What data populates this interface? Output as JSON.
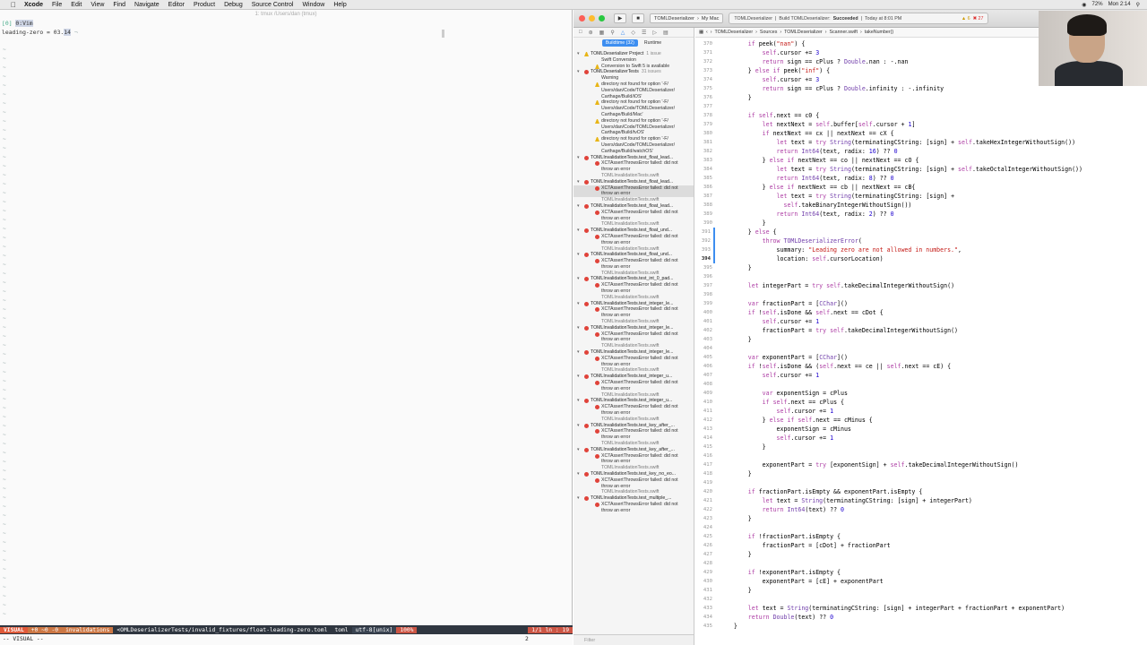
{
  "menubar": {
    "app": "Xcode",
    "items": [
      "File",
      "Edit",
      "View",
      "Find",
      "Navigate",
      "Editor",
      "Product",
      "Debug",
      "Source Control",
      "Window",
      "Help"
    ],
    "right": [
      "72%",
      "Mon 2:14"
    ]
  },
  "terminal": {
    "title": "1: tmux /Users/dan (tmux)",
    "line1_tag": "[0]",
    "line1_sel": "0:Vim",
    "line2_key": "leading-zero = ",
    "line2_val_a": "03.",
    "line2_val_b": "14",
    "status": {
      "mode": "VISUAL",
      "flags": "+0 ~0 -0",
      "branch": "invalidations",
      "file": "<OMLDeserializerTests/invalid_fixtures/float-leading-zero.toml",
      "ft": "toml",
      "enc": "utf-8[unix]",
      "pct": "100%",
      "pos": "1/1 ln : 19"
    },
    "cmd": "-- VISUAL --",
    "cmd_count": "2"
  },
  "xcode": {
    "toolbar": {
      "scheme_target": "TOMLDeserializer",
      "scheme_device": "My Mac",
      "activity_project": "TOMLDeserializer",
      "activity_action": "Build TOMLDeserializer:",
      "activity_status": "Succeeded",
      "activity_time": "Today at 8:01 PM",
      "warn_count": "6",
      "err_count": "27"
    },
    "navigator": {
      "seg_on": "Buildtime (32)",
      "seg_off": "Runtime",
      "filter": "Filter",
      "issues": [
        {
          "kind": "grp",
          "icon": "warn",
          "text": "TOMLDeserializer Project",
          "count": "1 issue"
        },
        {
          "kind": "sub",
          "icon": "",
          "text": "Swift Conversion"
        },
        {
          "kind": "msg",
          "icon": "warn",
          "text": "Conversion to Swift 5 is available"
        },
        {
          "kind": "grp",
          "icon": "err",
          "text": "TOMLDeserializerTests",
          "count": "31 issues"
        },
        {
          "kind": "sub",
          "icon": "",
          "text": "Warning"
        },
        {
          "kind": "msg",
          "icon": "warn",
          "text": "directory not found for option '-F/\nUsers/dan/Code/TOMLDeserializer/\nCarthage/Build/iOS'"
        },
        {
          "kind": "msg",
          "icon": "warn",
          "text": "directory not found for option '-F/\nUsers/dan/Code/TOMLDeserializer/\nCarthage/Build/Mac'"
        },
        {
          "kind": "msg",
          "icon": "warn",
          "text": "directory not found for option '-F/\nUsers/dan/Code/TOMLDeserializer/\nCarthage/Build/tvOS'"
        },
        {
          "kind": "msg",
          "icon": "warn",
          "text": "directory not found for option '-F/\nUsers/dan/Code/TOMLDeserializer/\nCarthage/Build/watchOS'"
        },
        {
          "kind": "test",
          "icon": "err",
          "text": "TOMLInvalidationTests.test_float_lead..."
        },
        {
          "kind": "fail",
          "icon": "err",
          "text": "XCTAssertThrowsError failed: did not\nthrow an error"
        },
        {
          "kind": "fn",
          "icon": "",
          "text": "TOMLInvalidationTests.swift"
        },
        {
          "kind": "test",
          "icon": "err",
          "text": "TOMLInvalidationTests.test_float_lead..."
        },
        {
          "kind": "fail",
          "icon": "err",
          "text": "XCTAssertThrowsError failed: did not\nthrow an error"
        },
        {
          "kind": "fn",
          "icon": "",
          "text": "TOMLInvalidationTests.swift"
        },
        {
          "kind": "test",
          "icon": "err",
          "text": "TOMLInvalidationTests.test_float_lead..."
        },
        {
          "kind": "fail",
          "icon": "err",
          "text": "XCTAssertThrowsError failed: did not\nthrow an error"
        },
        {
          "kind": "fn",
          "icon": "",
          "text": "TOMLInvalidationTests.swift"
        },
        {
          "kind": "test",
          "icon": "err",
          "text": "TOMLInvalidationTests.test_float_und..."
        },
        {
          "kind": "fail",
          "icon": "err",
          "text": "XCTAssertThrowsError failed: did not\nthrow an error"
        },
        {
          "kind": "fn",
          "icon": "",
          "text": "TOMLInvalidationTests.swift"
        },
        {
          "kind": "test",
          "icon": "err",
          "text": "TOMLInvalidationTests.test_float_und..."
        },
        {
          "kind": "fail",
          "icon": "err",
          "text": "XCTAssertThrowsError failed: did not\nthrow an error"
        },
        {
          "kind": "fn",
          "icon": "",
          "text": "TOMLInvalidationTests.swift"
        },
        {
          "kind": "test",
          "icon": "err",
          "text": "TOMLInvalidationTests.test_int_0_pad..."
        },
        {
          "kind": "fail",
          "icon": "err",
          "text": "XCTAssertThrowsError failed: did not\nthrow an error"
        },
        {
          "kind": "fn",
          "icon": "",
          "text": "TOMLInvalidationTests.swift"
        },
        {
          "kind": "test",
          "icon": "err",
          "text": "TOMLInvalidationTests.test_integer_le..."
        },
        {
          "kind": "fail",
          "icon": "err",
          "text": "XCTAssertThrowsError failed: did not\nthrow an error"
        },
        {
          "kind": "fn",
          "icon": "",
          "text": "TOMLInvalidationTests.swift"
        },
        {
          "kind": "test",
          "icon": "err",
          "text": "TOMLInvalidationTests.test_integer_le..."
        },
        {
          "kind": "fail",
          "icon": "err",
          "text": "XCTAssertThrowsError failed: did not\nthrow an error"
        },
        {
          "kind": "fn",
          "icon": "",
          "text": "TOMLInvalidationTests.swift"
        },
        {
          "kind": "test",
          "icon": "err",
          "text": "TOMLInvalidationTests.test_integer_le..."
        },
        {
          "kind": "fail",
          "icon": "err",
          "text": "XCTAssertThrowsError failed: did not\nthrow an error"
        },
        {
          "kind": "fn",
          "icon": "",
          "text": "TOMLInvalidationTests.swift"
        },
        {
          "kind": "test",
          "icon": "err",
          "text": "TOMLInvalidationTests.test_integer_u..."
        },
        {
          "kind": "fail",
          "icon": "err",
          "text": "XCTAssertThrowsError failed: did not\nthrow an error"
        },
        {
          "kind": "fn",
          "icon": "",
          "text": "TOMLInvalidationTests.swift"
        },
        {
          "kind": "test",
          "icon": "err",
          "text": "TOMLInvalidationTests.test_integer_u..."
        },
        {
          "kind": "fail",
          "icon": "err",
          "text": "XCTAssertThrowsError failed: did not\nthrow an error"
        },
        {
          "kind": "fn",
          "icon": "",
          "text": "TOMLInvalidationTests.swift"
        },
        {
          "kind": "test",
          "icon": "err",
          "text": "TOMLInvalidationTests.test_key_after_..."
        },
        {
          "kind": "fail",
          "icon": "err",
          "text": "XCTAssertThrowsError failed: did not\nthrow an error"
        },
        {
          "kind": "fn",
          "icon": "",
          "text": "TOMLInvalidationTests.swift"
        },
        {
          "kind": "test",
          "icon": "err",
          "text": "TOMLInvalidationTests.test_key_after_..."
        },
        {
          "kind": "fail",
          "icon": "err",
          "text": "XCTAssertThrowsError failed: did not\nthrow an error"
        },
        {
          "kind": "fn",
          "icon": "",
          "text": "TOMLInvalidationTests.swift"
        },
        {
          "kind": "test",
          "icon": "err",
          "text": "TOMLInvalidationTests.test_key_no_eo..."
        },
        {
          "kind": "fail",
          "icon": "err",
          "text": "XCTAssertThrowsError failed: did not\nthrow an error"
        },
        {
          "kind": "fn",
          "icon": "",
          "text": "TOMLInvalidationTests.swift"
        },
        {
          "kind": "test",
          "icon": "err",
          "text": "TOMLInvalidationTests.test_multiple_..."
        },
        {
          "kind": "fail",
          "icon": "err",
          "text": "XCTAssertThrowsError failed: did not\nthrow an error"
        }
      ]
    },
    "jumpbar": [
      "TOMLDeserializer",
      "Sources",
      "TOMLDeserializer",
      "Scanner.swift",
      "takeNumber()"
    ],
    "code": [
      {
        "n": "370",
        "t": "        if peek(\"nan\") {"
      },
      {
        "n": "371",
        "t": "            self.cursor += 3"
      },
      {
        "n": "372",
        "t": "            return sign == cPlus ? Double.nan : -.nan"
      },
      {
        "n": "373",
        "t": "        } else if peek(\"inf\") {"
      },
      {
        "n": "374",
        "t": "            self.cursor += 3"
      },
      {
        "n": "375",
        "t": "            return sign == cPlus ? Double.infinity : -.infinity"
      },
      {
        "n": "376",
        "t": "        }"
      },
      {
        "n": "377",
        "t": ""
      },
      {
        "n": "378",
        "t": "        if self.next == c0 {"
      },
      {
        "n": "379",
        "t": "            let nextNext = self.buffer[self.cursor + 1]"
      },
      {
        "n": "380",
        "t": "            if nextNext == cx || nextNext == cX {"
      },
      {
        "n": "381",
        "t": "                let text = try String(terminatingCString: [sign] + self.takeHexIntegerWithoutSign())"
      },
      {
        "n": "382",
        "t": "                return Int64(text, radix: 16) ?? 0"
      },
      {
        "n": "383",
        "t": "            } else if nextNext == co || nextNext == cO {"
      },
      {
        "n": "384",
        "t": "                let text = try String(terminatingCString: [sign] + self.takeOctalIntegerWithoutSign())"
      },
      {
        "n": "385",
        "t": "                return Int64(text, radix: 8) ?? 0"
      },
      {
        "n": "386",
        "t": "            } else if nextNext == cb || nextNext == cB{"
      },
      {
        "n": "387",
        "t": "                let text = try String(terminatingCString: [sign] +"
      },
      {
        "n": "388",
        "t": "                  self.takeBinaryIntegerWithoutSign())"
      },
      {
        "n": "389",
        "t": "                return Int64(text, radix: 2) ?? 0"
      },
      {
        "n": "390",
        "t": "            }"
      },
      {
        "n": "391",
        "t": "        } else {"
      },
      {
        "n": "392",
        "t": "            throw TOMLDeserializerError("
      },
      {
        "n": "393",
        "t": "                summary: \"Leading zero are not allowed in numbers.\","
      },
      {
        "n": "394",
        "t": "                location: self.cursorLocation)"
      },
      {
        "n": "395",
        "t": "        }"
      },
      {
        "n": "396",
        "t": ""
      },
      {
        "n": "397",
        "t": "        let integerPart = try self.takeDecimalIntegerWithoutSign()"
      },
      {
        "n": "398",
        "t": ""
      },
      {
        "n": "399",
        "t": "        var fractionPart = [CChar]()"
      },
      {
        "n": "400",
        "t": "        if !self.isDone && self.next == cDot {"
      },
      {
        "n": "401",
        "t": "            self.cursor += 1"
      },
      {
        "n": "402",
        "t": "            fractionPart = try self.takeDecimalIntegerWithoutSign()"
      },
      {
        "n": "403",
        "t": "        }"
      },
      {
        "n": "404",
        "t": ""
      },
      {
        "n": "405",
        "t": "        var exponentPart = [CChar]()"
      },
      {
        "n": "406",
        "t": "        if !self.isDone && (self.next == ce || self.next == cE) {"
      },
      {
        "n": "407",
        "t": "            self.cursor += 1"
      },
      {
        "n": "408",
        "t": ""
      },
      {
        "n": "409",
        "t": "            var exponentSign = cPlus"
      },
      {
        "n": "410",
        "t": "            if self.next == cPlus {"
      },
      {
        "n": "411",
        "t": "                self.cursor += 1"
      },
      {
        "n": "412",
        "t": "            } else if self.next == cMinus {"
      },
      {
        "n": "413",
        "t": "                exponentSign = cMinus"
      },
      {
        "n": "414",
        "t": "                self.cursor += 1"
      },
      {
        "n": "415",
        "t": "            }"
      },
      {
        "n": "416",
        "t": ""
      },
      {
        "n": "417",
        "t": "            exponentPart = try [exponentSign] + self.takeDecimalIntegerWithoutSign()"
      },
      {
        "n": "418",
        "t": "        }"
      },
      {
        "n": "419",
        "t": ""
      },
      {
        "n": "420",
        "t": "        if fractionPart.isEmpty && exponentPart.isEmpty {"
      },
      {
        "n": "421",
        "t": "            let text = String(terminatingCString: [sign] + integerPart)"
      },
      {
        "n": "422",
        "t": "            return Int64(text) ?? 0"
      },
      {
        "n": "423",
        "t": "        }"
      },
      {
        "n": "424",
        "t": ""
      },
      {
        "n": "425",
        "t": "        if !fractionPart.isEmpty {"
      },
      {
        "n": "426",
        "t": "            fractionPart = [cDot] + fractionPart"
      },
      {
        "n": "427",
        "t": "        }"
      },
      {
        "n": "428",
        "t": ""
      },
      {
        "n": "429",
        "t": "        if !exponentPart.isEmpty {"
      },
      {
        "n": "430",
        "t": "            exponentPart = [cE] + exponentPart"
      },
      {
        "n": "431",
        "t": "        }"
      },
      {
        "n": "432",
        "t": ""
      },
      {
        "n": "433",
        "t": "        let text = String(terminatingCString: [sign] + integerPart + fractionPart + exponentPart)"
      },
      {
        "n": "434",
        "t": "        return Double(text) ?? 0"
      },
      {
        "n": "435",
        "t": "    }"
      }
    ]
  },
  "colors": {
    "accent": "#3d8ef0",
    "error": "#e0433a",
    "warning": "#e8b516",
    "keyword": "#ad3da4"
  }
}
